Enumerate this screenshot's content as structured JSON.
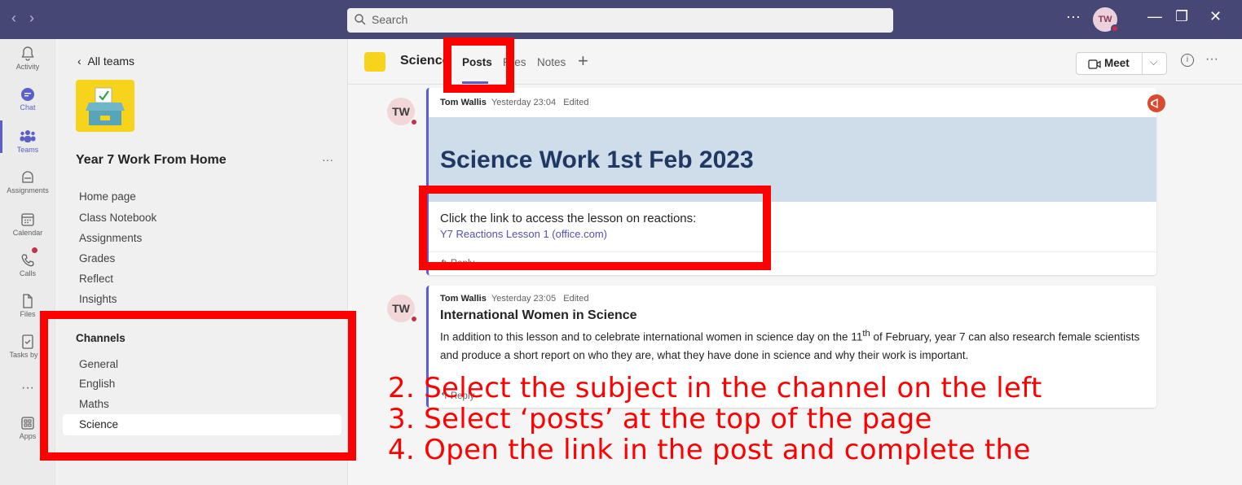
{
  "titlebar": {
    "search_placeholder": "Search",
    "more": "···",
    "avatar_initials": "TW"
  },
  "rail": {
    "items": [
      {
        "label": "Activity",
        "icon": "bell-icon"
      },
      {
        "label": "Chat",
        "icon": "chat-icon"
      },
      {
        "label": "Teams",
        "icon": "teams-icon"
      },
      {
        "label": "Assignments",
        "icon": "assignments-icon"
      },
      {
        "label": "Calendar",
        "icon": "calendar-icon"
      },
      {
        "label": "Calls",
        "icon": "phone-icon"
      },
      {
        "label": "Files",
        "icon": "file-icon"
      },
      {
        "label": "Tasks by ...",
        "icon": "tasks-icon"
      },
      {
        "label": "···",
        "icon": "more-icon"
      },
      {
        "label": "Apps",
        "icon": "apps-icon"
      }
    ],
    "active": "Teams"
  },
  "team_pane": {
    "back_label": "All teams",
    "team_name": "Year 7 Work From Home",
    "more": "···",
    "links": [
      "Home page",
      "Class Notebook",
      "Assignments",
      "Grades",
      "Reflect",
      "Insights"
    ],
    "channels_heading": "Channels",
    "channels": [
      "General",
      "English",
      "Maths",
      "Science"
    ],
    "selected_channel": "Science"
  },
  "header": {
    "channel_name": "Science",
    "tabs": [
      "Posts",
      "Files",
      "Notes"
    ],
    "active_tab": "Posts",
    "meet_label": "Meet",
    "more": "···"
  },
  "posts": [
    {
      "avatar": "TW",
      "author": "Tom Wallis",
      "time": "Yesterday 23:04",
      "status": "Edited",
      "title": "Science Work 1st Feb 2023",
      "subtitle": "Click the link to access the lesson on reactions:",
      "link_text": "Y7 Reactions Lesson 1 (office.com)",
      "reply": "Reply"
    },
    {
      "avatar": "TW",
      "author": "Tom Wallis",
      "time": "Yesterday 23:05",
      "status": "Edited",
      "title": "International Women in Science",
      "body_start": "In addition to this lesson and to celebrate international women in science day on the 11",
      "body_sup": "th",
      "body_end": " of February, year 7 can also research female scientists and produce a short report on who they are, what they have done in science and why their work is important.",
      "reply": "Reply"
    }
  ],
  "instructions": [
    "2. Select the subject in the channel on the left",
    "3. Select ‘posts’ at the top of the page",
    "4. Open the link in the post and complete the"
  ],
  "colors": {
    "titlebar": "#464775",
    "accent": "#5b5fc7",
    "annotation": "#ff0000",
    "banner": "#cfdcea",
    "banner_text": "#1f3864"
  }
}
